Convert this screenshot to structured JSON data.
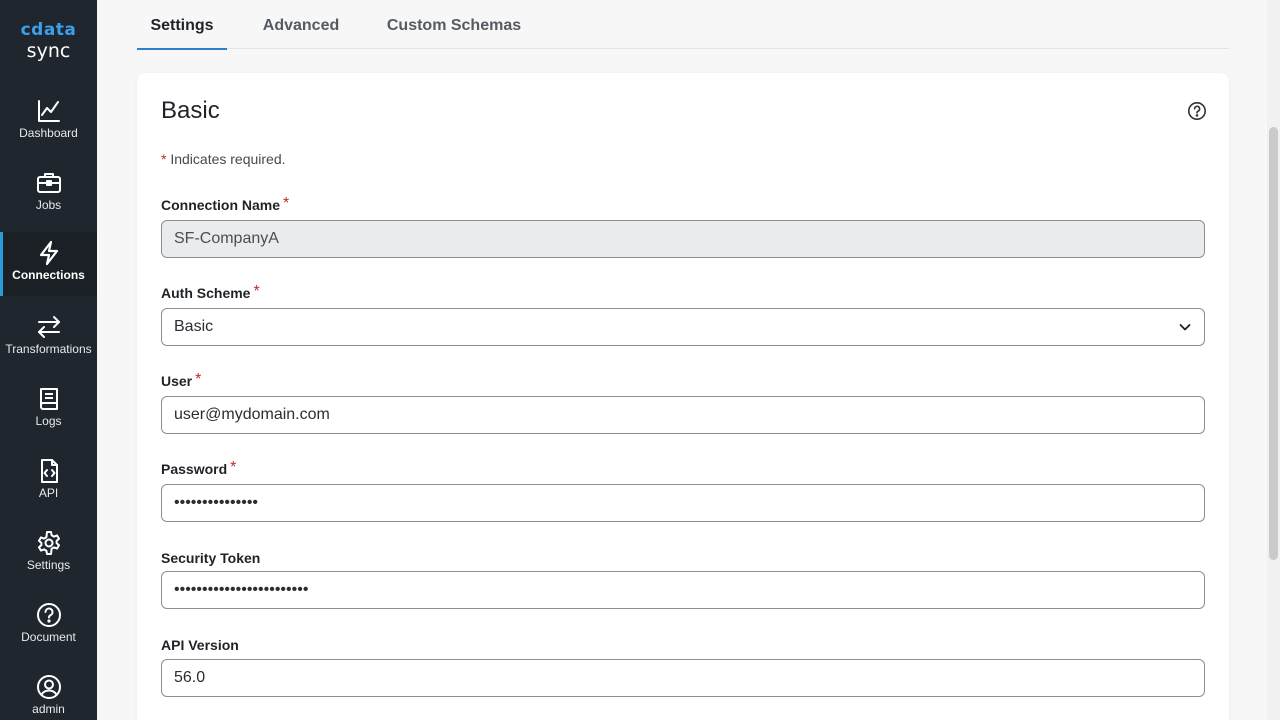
{
  "logo": {
    "mark": "cdata",
    "sub": "sync"
  },
  "sidebar": {
    "items": [
      {
        "label": "Dashboard",
        "icon": "chart-line-icon"
      },
      {
        "label": "Jobs",
        "icon": "briefcase-icon"
      },
      {
        "label": "Connections",
        "icon": "lightning-icon",
        "active": true
      },
      {
        "label": "Transformations",
        "icon": "arrows-exchange-icon"
      },
      {
        "label": "Logs",
        "icon": "book-icon"
      },
      {
        "label": "API",
        "icon": "code-file-icon"
      },
      {
        "label": "Settings",
        "icon": "gear-icon"
      },
      {
        "label": "Document",
        "icon": "question-circle-icon"
      },
      {
        "label": "admin",
        "icon": "user-circle-icon"
      }
    ]
  },
  "tabs": [
    {
      "label": "Settings",
      "active": true
    },
    {
      "label": "Advanced"
    },
    {
      "label": "Custom Schemas"
    }
  ],
  "section": {
    "title": "Basic",
    "required_note": "Indicates required.",
    "required_star": "*"
  },
  "fields": {
    "connection_name": {
      "label": "Connection Name",
      "value": "SF-CompanyA",
      "required": true
    },
    "auth_scheme": {
      "label": "Auth Scheme",
      "value": "Basic",
      "required": true
    },
    "user": {
      "label": "User",
      "value": "user@mydomain.com",
      "required": true
    },
    "password": {
      "label": "Password",
      "value": "•••••••••••••••",
      "required": true
    },
    "security_token": {
      "label": "Security Token",
      "value": "••••••••••••••••••••••••"
    },
    "api_version": {
      "label": "API Version",
      "value": "56.0"
    }
  },
  "colors": {
    "sidebar_bg": "#20262e",
    "accent": "#2d9cdb",
    "required": "#c62828",
    "logo": "#3aa0ec"
  }
}
